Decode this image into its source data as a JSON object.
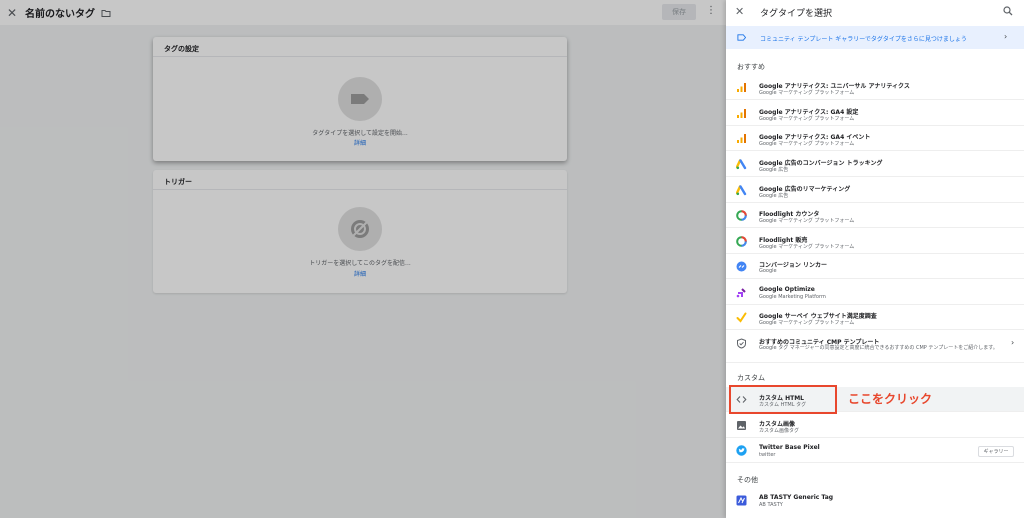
{
  "editor": {
    "title": "名前のないタグ",
    "save_label": "保存",
    "tag_card": {
      "heading": "タグの設定",
      "placeholder": "タグタイプを選択して設定を開始...",
      "link": "詳細"
    },
    "trigger_card": {
      "heading": "トリガー",
      "placeholder": "トリガーを選択してこのタグを配信...",
      "link": "詳細"
    }
  },
  "panel": {
    "title": "タグタイプを選択",
    "community_banner": "コミュニティ テンプレート ギャラリーでタグタイプをさらに見つけましょう",
    "sections": {
      "featured": "おすすめ",
      "custom": "カスタム",
      "other": "その他"
    },
    "featured_items": [
      {
        "icon": "google-analytics-icon",
        "name": "Google アナリティクス: ユニバーサル アナリティクス",
        "sub": "Google マーケティング プラットフォーム"
      },
      {
        "icon": "google-analytics-icon",
        "name": "Google アナリティクス: GA4 設定",
        "sub": "Google マーケティング プラットフォーム"
      },
      {
        "icon": "google-analytics-icon",
        "name": "Google アナリティクス: GA4 イベント",
        "sub": "Google マーケティング プラットフォーム"
      },
      {
        "icon": "google-ads-icon",
        "name": "Google 広告のコンバージョン トラッキング",
        "sub": "Google 広告"
      },
      {
        "icon": "google-ads-icon",
        "name": "Google 広告のリマーケティング",
        "sub": "Google 広告"
      },
      {
        "icon": "floodlight-icon",
        "name": "Floodlight カウンタ",
        "sub": "Google マーケティング プラットフォーム"
      },
      {
        "icon": "floodlight-icon",
        "name": "Floodlight 販売",
        "sub": "Google マーケティング プラットフォーム"
      },
      {
        "icon": "conversion-linker-icon",
        "name": "コンバージョン リンカー",
        "sub": "Google"
      },
      {
        "icon": "google-optimize-icon",
        "name": "Google Optimize",
        "sub": "Google Marketing Platform"
      },
      {
        "icon": "google-surveys-icon",
        "name": "Google サーベイ ウェブサイト満足度調査",
        "sub": "Google マーケティング プラットフォーム"
      },
      {
        "icon": "shield-icon",
        "name": "おすすめのコミュニティ CMP テンプレート",
        "sub": "Google タグ マネージャーの同意設定と高度に統合できるおすすめの CMP テンプレートをご紹介します。"
      }
    ],
    "custom_items": [
      {
        "icon": "code-icon",
        "name": "カスタム HTML",
        "sub": "カスタム HTML タグ"
      },
      {
        "icon": "image-icon",
        "name": "カスタム画像",
        "sub": "カスタム画像タグ"
      },
      {
        "icon": "twitter-icon",
        "name": "Twitter Base Pixel",
        "sub": "twitter",
        "badge": "ギャラリー"
      }
    ],
    "other_items": [
      {
        "icon": "ab-tasty-icon",
        "name": "AB TASTY Generic Tag",
        "sub": "AB TASTY"
      }
    ]
  },
  "annotation": {
    "text": "ここをクリック",
    "color": "#e8472d"
  },
  "colors": {
    "accent": "#1a73e8",
    "annotation": "#e8472d"
  }
}
